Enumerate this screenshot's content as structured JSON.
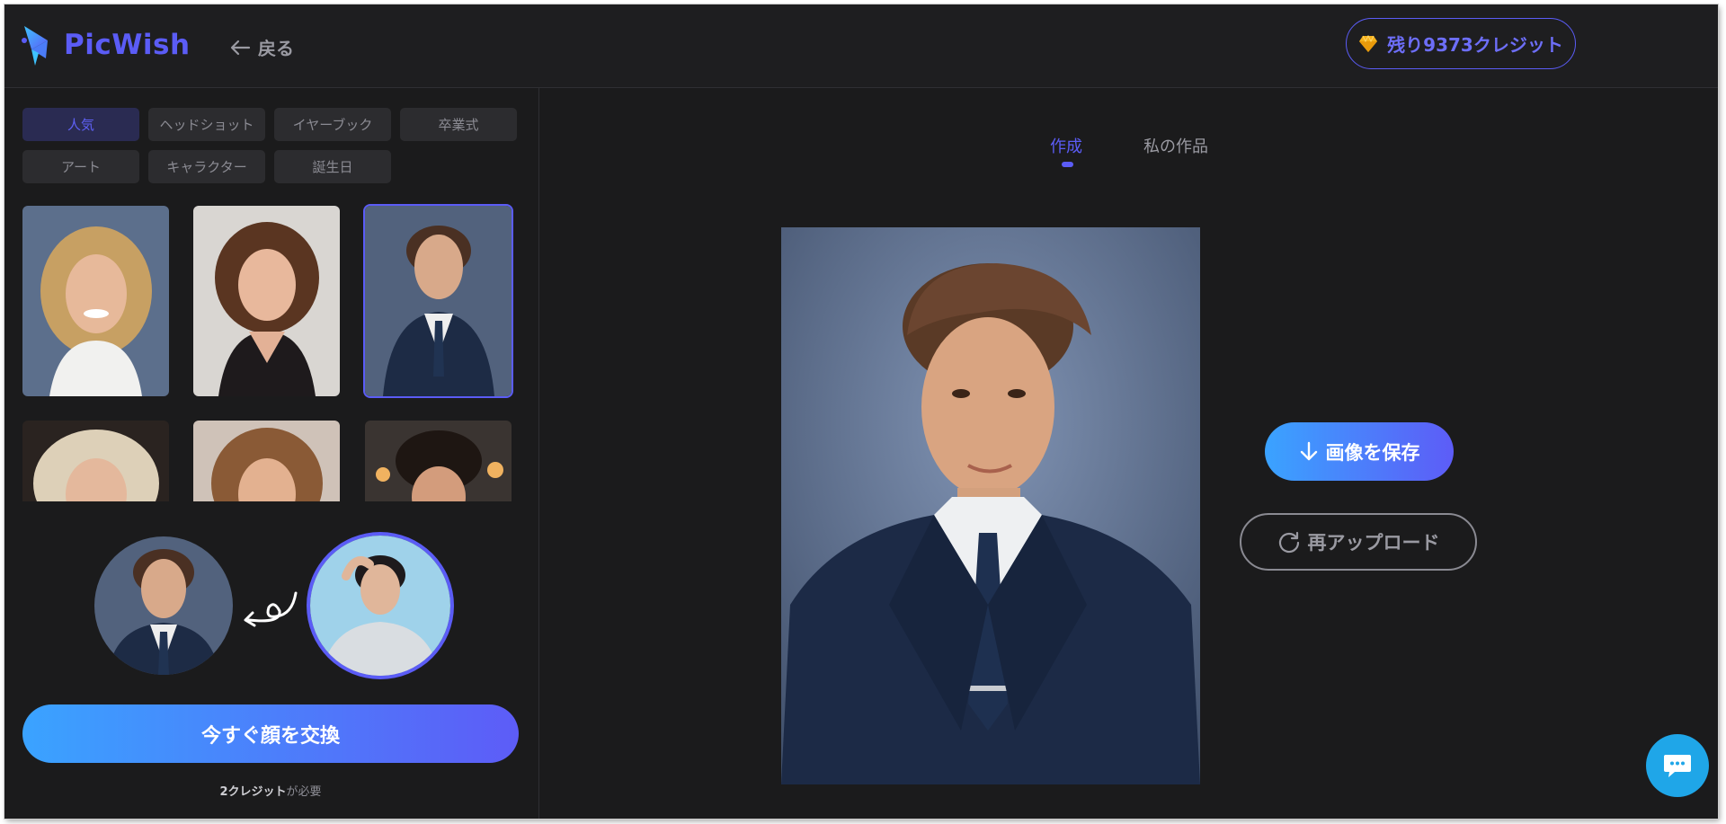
{
  "brand": {
    "name": "PicWish",
    "logo_icon": "picwish-logo-icon",
    "accent": "#5b5cf6"
  },
  "header": {
    "back_label": "戻る",
    "credits_label": "残り9373クレジット",
    "credits_icon": "diamond-icon"
  },
  "categories": [
    "人気",
    "ヘッドショット",
    "イヤーブック",
    "卒業式",
    "アート",
    "キャラクター",
    "誕生日"
  ],
  "active_category": "人気",
  "templates": [
    {
      "name": "template-curly-blonde-woman"
    },
    {
      "name": "template-brunette-woman-bob"
    },
    {
      "name": "template-man-in-suit",
      "selected": true
    },
    {
      "name": "template-curly-blonde-woman-2"
    },
    {
      "name": "template-woman-wavy-hair"
    },
    {
      "name": "template-man-curly-hair"
    }
  ],
  "swap": {
    "target_avatar": "template-face-avatar",
    "source_avatar": "uploaded-face-avatar",
    "arrow_icon": "curved-arrow-icon"
  },
  "swap_button": "今すぐ顔を交換",
  "cost_note": {
    "amount": "2クレジット",
    "suffix": "が必要"
  },
  "tabs": [
    {
      "label": "作成",
      "active": true
    },
    {
      "label": "私の作品",
      "active": false
    }
  ],
  "actions": {
    "save_label": "画像を保存",
    "reupload_label": "再アップロード"
  },
  "chat_icon": "chat-bubble-icon"
}
